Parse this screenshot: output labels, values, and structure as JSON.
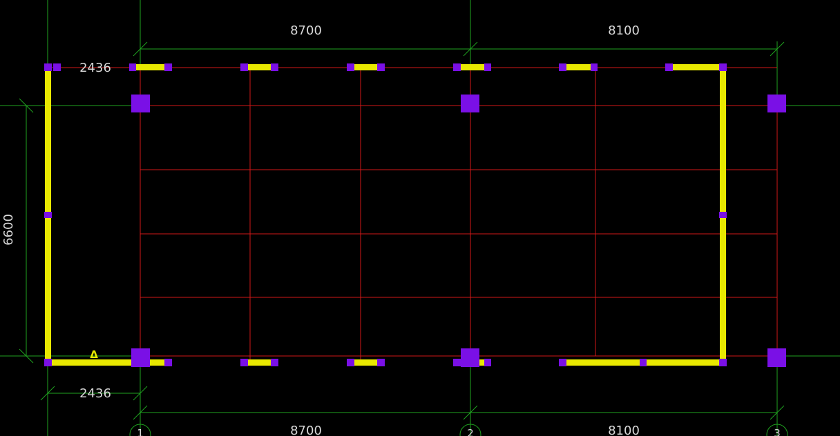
{
  "colors": {
    "background": "#000000",
    "grid": "#1fa31f",
    "beam": "#d21818",
    "wall": "#e8e800",
    "column": "#7a10e6",
    "text": "#d8d8d8"
  },
  "dimensions": {
    "top_bay_1": "8700",
    "top_bay_2": "8100",
    "bottom_bay_1": "8700",
    "bottom_bay_2": "8100",
    "top_left": "2436",
    "bottom_left": "2436",
    "left_vertical": "6600"
  },
  "axis_labels": {
    "axis_1": "1",
    "axis_2": "2",
    "axis_3": "3"
  },
  "marker": {
    "symbol": "triangle-marker",
    "glyph": "Δ"
  }
}
